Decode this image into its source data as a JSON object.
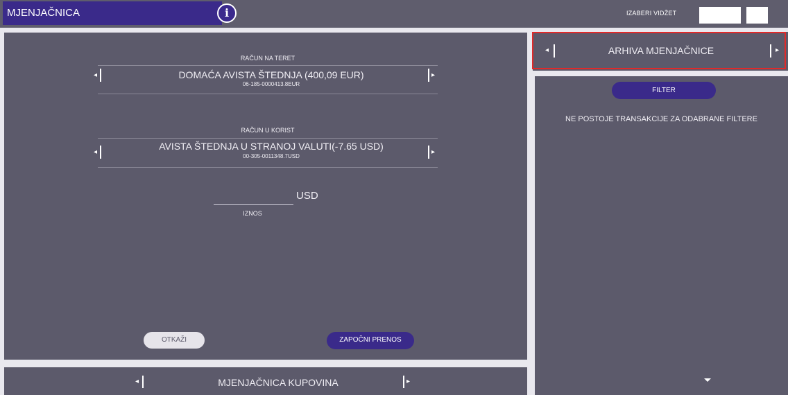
{
  "app": {
    "title": "MJENJAČNICA",
    "info_glyph": "i"
  },
  "topbar": {
    "widget_label": "IZABERI VIDŽET"
  },
  "debit": {
    "label": "RAČUN NA TERET",
    "account_name": "DOMAĆA AVISTA ŠTEDNJA (400,09 EUR)",
    "account_number": "06-185-0000413.8EUR"
  },
  "credit": {
    "label": "RAČUN U KORIST",
    "account_name": "AVISTA ŠTEDNJA U STRANOJ VALUTI(-7.65 USD)",
    "account_number": "00-305-0011348.7USD"
  },
  "amount": {
    "currency": "USD",
    "label": "IZNOS",
    "value": ""
  },
  "actions": {
    "cancel": "OTKAŽI",
    "start": "ZAPOČNI PRENOS"
  },
  "bottom_tab": {
    "label": "MJENJAČNICA KUPOVINA"
  },
  "archive": {
    "title": "ARHIVA MJENJAČNICE",
    "filter_label": "FILTER",
    "empty_message": "NE POSTOJE TRANSAKCIJE ZA ODABRANE FILTERE"
  },
  "colors": {
    "accent": "#3a2a8a",
    "panel": "#5c5a6b",
    "highlight": "#e02a2a"
  },
  "icons": [
    "info-icon",
    "chevron-left-icon",
    "chevron-right-icon",
    "caret-down-icon"
  ]
}
